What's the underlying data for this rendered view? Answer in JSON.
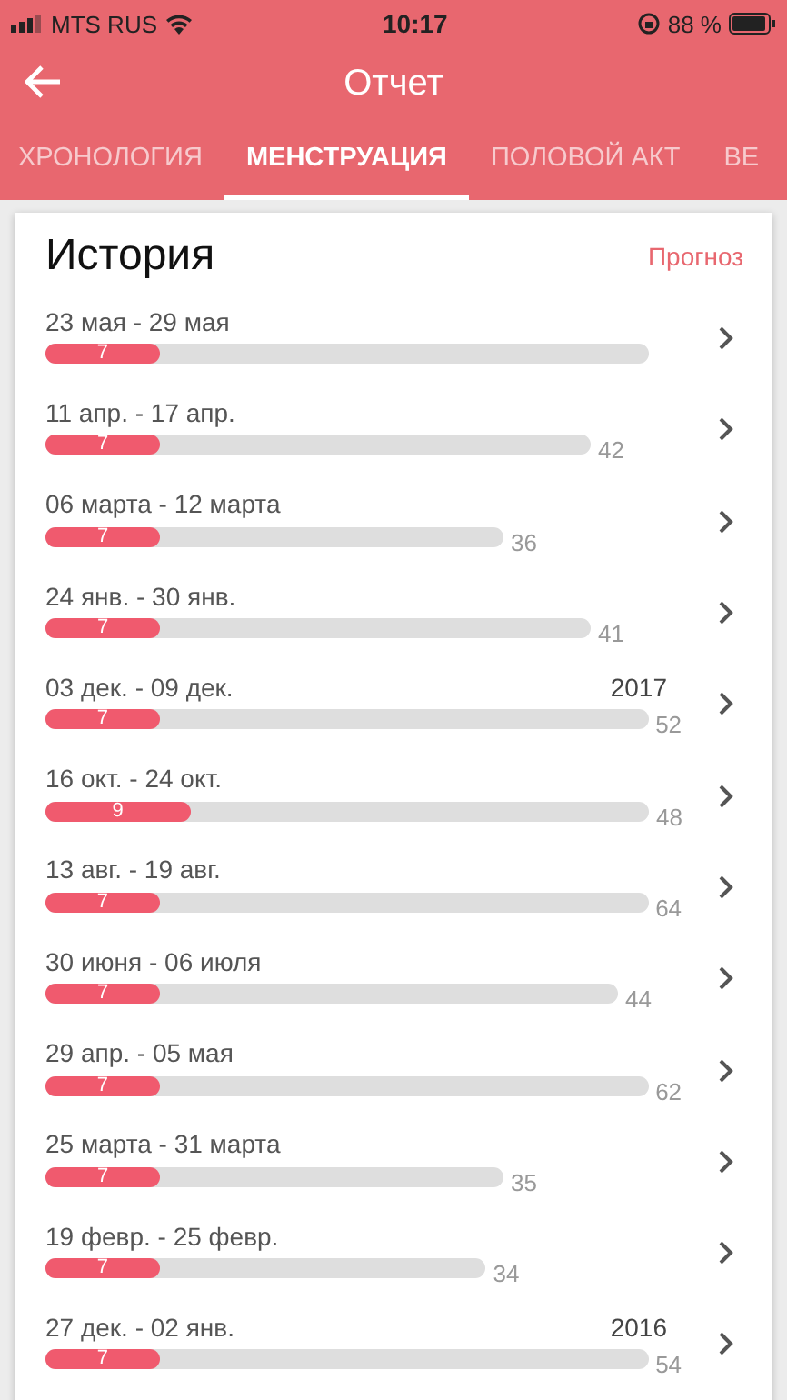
{
  "status_bar": {
    "carrier": "MTS RUS",
    "time": "10:17",
    "battery": "88 %"
  },
  "header": {
    "title": "Отчет"
  },
  "tabs": [
    {
      "label": "ХРОНОЛОГИЯ",
      "selected": false
    },
    {
      "label": "МЕНСТРУАЦИЯ",
      "selected": true
    },
    {
      "label": "ПОЛОВОЙ АКТ",
      "selected": false
    },
    {
      "label": "ВЕ",
      "selected": false
    }
  ],
  "history": {
    "title": "История",
    "forecast_link": "Прогноз",
    "rows": [
      {
        "dates": "23 мая - 29 мая",
        "period": "7",
        "level": 0.19
      },
      {
        "dates": "11 апр. - 17 апр.",
        "period": "7",
        "cycle": "42",
        "level": 0.21
      },
      {
        "dates": "06 марта - 12 марта",
        "period": "7",
        "cycle": "36",
        "level": 0.25
      },
      {
        "dates": "24 янв. - 30 янв.",
        "period": "7",
        "cycle": "41",
        "level": 0.21
      },
      {
        "dates": "03 дек. - 09 дек.",
        "year": "2017",
        "period": "7",
        "cycle": "52",
        "level": 0.19
      },
      {
        "dates": "16 окт. - 24 окт.",
        "period": "9",
        "cycle": "48",
        "level": 0.24
      },
      {
        "dates": "13 авг. - 19 авг.",
        "period": "7",
        "cycle": "64",
        "level": 0.19
      },
      {
        "dates": "30 июня - 06 июля",
        "period": "7",
        "cycle": "44",
        "level": 0.2
      },
      {
        "dates": "29 апр. - 05 мая",
        "period": "7",
        "cycle": "62",
        "level": 0.19
      },
      {
        "dates": "25 марта - 31 марта",
        "period": "7",
        "cycle": "35",
        "level": 0.25
      },
      {
        "dates": "19 февр. - 25 февр.",
        "period": "7",
        "cycle": "34",
        "level": 0.26
      },
      {
        "dates": "27 дек. - 02 янв.",
        "year": "2016",
        "period": "7",
        "cycle": "54",
        "level": 0.19
      }
    ]
  }
}
